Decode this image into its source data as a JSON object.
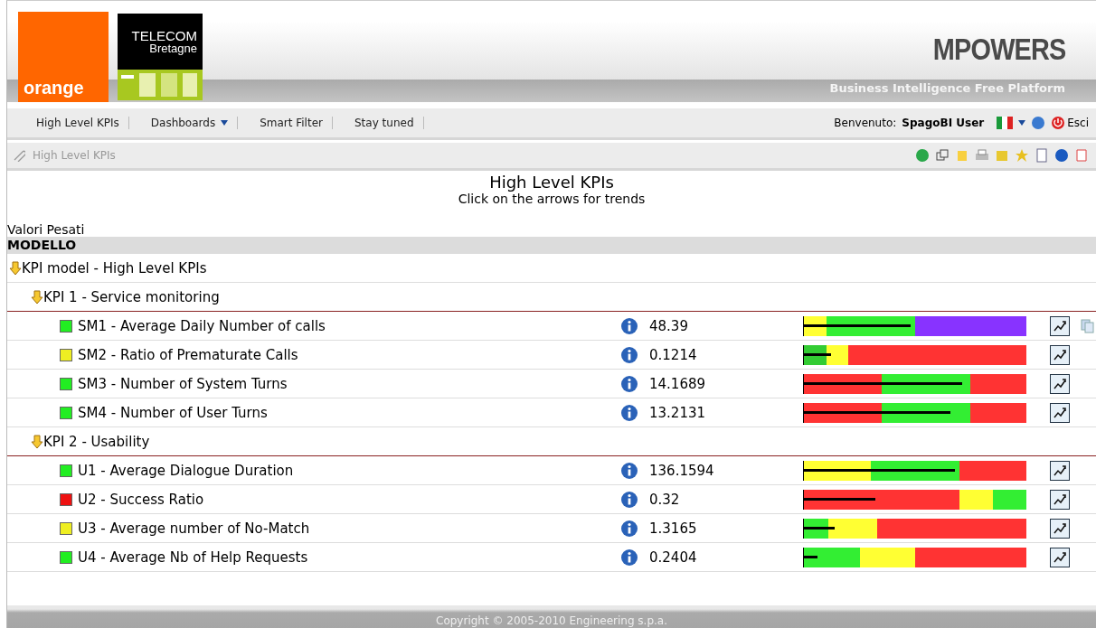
{
  "header": {
    "logo_orange": "orange",
    "logo_telecom_1": "TELECOM",
    "logo_telecom_2": "Bretagne",
    "brand": "MPOWERS",
    "tagline": "Business Intelligence Free Platform"
  },
  "menu": {
    "items": [
      {
        "label": "High Level KPIs",
        "dropdown": false
      },
      {
        "label": "Dashboards",
        "dropdown": true
      },
      {
        "label": "Smart Filter",
        "dropdown": false
      },
      {
        "label": "Stay tuned",
        "dropdown": false
      }
    ],
    "welcome": "Benvenuto:",
    "user": "SpagoBI User",
    "logout": "Esci"
  },
  "breadcrumb": "High Level KPIs",
  "title": "High Level KPIs",
  "subtitle": "Click on the arrows for trends",
  "section_label": "Valori Pesati",
  "table_header": "MODELLO",
  "tree": {
    "label": "KPI model - High Level KPIs",
    "expanded": true,
    "children": [
      {
        "label": "KPI 1 - Service monitoring",
        "expanded": true,
        "children": [
          {
            "label": "SM1 - Average Daily Number of calls",
            "color": "#22ee22",
            "value": "48.39",
            "level": 0.48,
            "attachment": true,
            "segments": [
              {
                "color": "#ffff33"
              },
              {
                "color": "#33ee33"
              },
              {
                "color": "#8833ff"
              }
            ]
          },
          {
            "label": "SM2 - Ratio of Prematurate Calls",
            "color": "#eeee22",
            "value": "0.1214",
            "level": 0.12,
            "attachment": false,
            "segments": [
              {
                "color": "#33cc33"
              },
              {
                "color": "#ffff33"
              },
              {
                "color": "#ff3333"
              }
            ]
          },
          {
            "label": "SM3 - Number of System Turns",
            "color": "#22ee22",
            "value": "14.1689",
            "level": 0.71,
            "attachment": false,
            "segments": [
              {
                "color": "#ff3333"
              },
              {
                "color": "#33ee33"
              },
              {
                "color": "#ff3333"
              }
            ]
          },
          {
            "label": "SM4 - Number of User Turns",
            "color": "#22ee22",
            "value": "13.2131",
            "level": 0.66,
            "attachment": false,
            "segments": [
              {
                "color": "#ff3333"
              },
              {
                "color": "#33ee33"
              },
              {
                "color": "#ff3333"
              }
            ]
          }
        ]
      },
      {
        "label": "KPI 2 - Usability",
        "expanded": true,
        "children": [
          {
            "label": "U1 - Average Dialogue Duration",
            "color": "#22ee22",
            "value": "136.1594",
            "level": 0.68,
            "attachment": false,
            "segments": [
              {
                "color": "#ffff33"
              },
              {
                "color": "#33ee33"
              },
              {
                "color": "#ff3333"
              }
            ]
          },
          {
            "label": "U2 - Success Ratio",
            "color": "#ee1111",
            "value": "0.32",
            "level": 0.32,
            "attachment": false,
            "segments": [
              {
                "color": "#ff3333"
              },
              {
                "color": "#ffff33"
              },
              {
                "color": "#33ee33"
              }
            ]
          },
          {
            "label": "U3 - Average number of No-Match",
            "color": "#eeee22",
            "value": "1.3165",
            "level": 0.14,
            "attachment": false,
            "segments": [
              {
                "color": "#33ee33"
              },
              {
                "color": "#ffff33"
              },
              {
                "color": "#ff3333"
              }
            ]
          },
          {
            "label": "U4 - Average Nb of Help Requests",
            "color": "#22ee22",
            "value": "0.2404",
            "level": 0.06,
            "attachment": false,
            "segments": [
              {
                "color": "#33ee33"
              },
              {
                "color": "#ffff33"
              },
              {
                "color": "#ff3333"
              }
            ]
          }
        ]
      }
    ]
  },
  "footer": "Copyright © 2005-2010 Engineering s.p.a."
}
